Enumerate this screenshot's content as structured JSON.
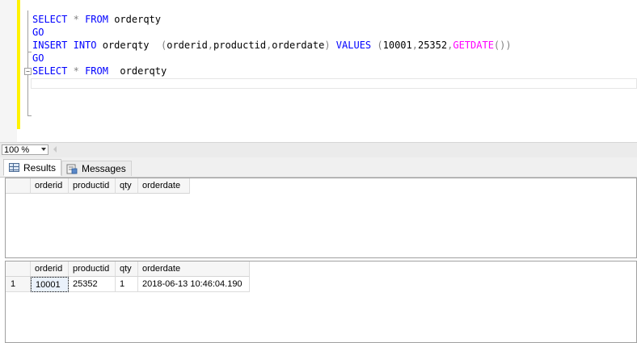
{
  "editor": {
    "lines": [
      [
        {
          "t": "SELECT",
          "c": "kw"
        },
        {
          "t": " "
        },
        {
          "t": "*",
          "c": "gr"
        },
        {
          "t": " "
        },
        {
          "t": "FROM",
          "c": "kw"
        },
        {
          "t": " orderqty"
        }
      ],
      [
        {
          "t": "GO",
          "c": "kw"
        }
      ],
      [
        {
          "t": "INSERT",
          "c": "kw"
        },
        {
          "t": " "
        },
        {
          "t": "INTO",
          "c": "kw"
        },
        {
          "t": " orderqty  "
        },
        {
          "t": "(",
          "c": "gr"
        },
        {
          "t": "orderid"
        },
        {
          "t": ",",
          "c": "gr"
        },
        {
          "t": "productid"
        },
        {
          "t": ",",
          "c": "gr"
        },
        {
          "t": "orderdate"
        },
        {
          "t": ")",
          "c": "gr"
        },
        {
          "t": " "
        },
        {
          "t": "VALUES",
          "c": "kw"
        },
        {
          "t": " "
        },
        {
          "t": "(",
          "c": "gr"
        },
        {
          "t": "10001"
        },
        {
          "t": ",",
          "c": "gr"
        },
        {
          "t": "25352"
        },
        {
          "t": ",",
          "c": "gr"
        },
        {
          "t": "GETDATE",
          "c": "fn"
        },
        {
          "t": "())",
          "c": "gr"
        }
      ],
      [
        {
          "t": "GO",
          "c": "kw"
        }
      ],
      [
        {
          "t": "SELECT",
          "c": "kw"
        },
        {
          "t": " "
        },
        {
          "t": "*",
          "c": "gr"
        },
        {
          "t": " "
        },
        {
          "t": "FROM",
          "c": "kw"
        },
        {
          "t": "  orderqty"
        }
      ]
    ],
    "collapse_symbol": "−"
  },
  "zoom": {
    "value": "100 %"
  },
  "tabs": {
    "results": "Results",
    "messages": "Messages"
  },
  "result1": {
    "columns": [
      "orderid",
      "productid",
      "qty",
      "orderdate"
    ]
  },
  "result2": {
    "columns": [
      "orderid",
      "productid",
      "qty",
      "orderdate"
    ],
    "rows": [
      {
        "num": "1",
        "orderid": "10001",
        "productid": "25352",
        "qty": "1",
        "orderdate": "2018-06-13 10:46:04.190"
      }
    ]
  },
  "colors": {
    "keyword": "#0000ff",
    "operator": "#808080",
    "function": "#ff00ff",
    "change_bar": "#fff200"
  }
}
